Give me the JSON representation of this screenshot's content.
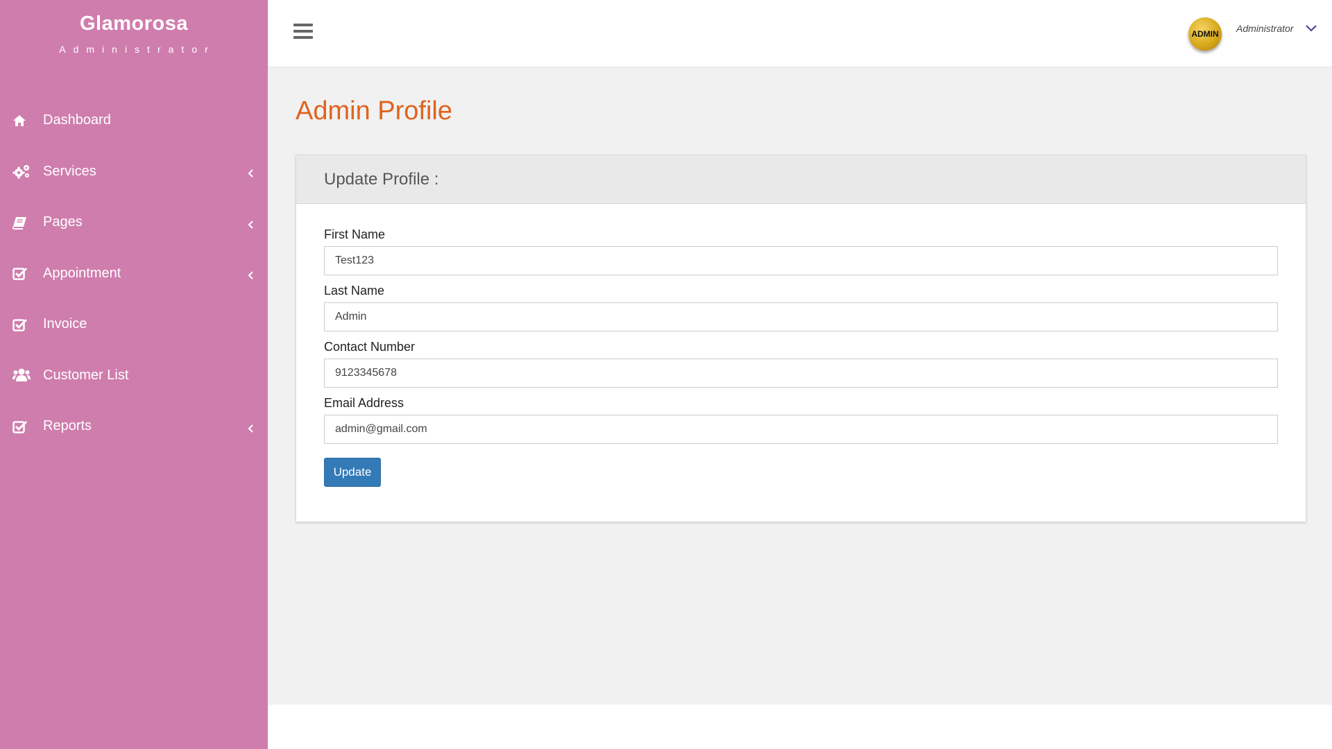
{
  "brand": {
    "title": "Glamorosa",
    "subtitle": "Administrator"
  },
  "sidebar": {
    "items": [
      {
        "label": "Dashboard",
        "icon": "home-icon",
        "has_submenu": false
      },
      {
        "label": "Services",
        "icon": "gears-icon",
        "has_submenu": true
      },
      {
        "label": "Pages",
        "icon": "book-icon",
        "has_submenu": true
      },
      {
        "label": "Appointment",
        "icon": "check-square-icon",
        "has_submenu": true
      },
      {
        "label": "Invoice",
        "icon": "check-square-icon",
        "has_submenu": false
      },
      {
        "label": "Customer List",
        "icon": "users-icon",
        "has_submenu": false
      },
      {
        "label": "Reports",
        "icon": "check-square-icon",
        "has_submenu": true
      }
    ]
  },
  "topbar": {
    "menu_icon": "hamburger-icon",
    "avatar_text": "ADMIN",
    "user_name": "Administrator",
    "dropdown_icon": "chevron-down-icon"
  },
  "main": {
    "page_title": "Admin Profile",
    "card_title": "Update Profile :",
    "fields": [
      {
        "label": "First Name",
        "value": "Test123"
      },
      {
        "label": "Last Name",
        "value": "Admin"
      },
      {
        "label": "Contact Number",
        "value": "9123345678"
      },
      {
        "label": "Email Address",
        "value": "admin@gmail.com"
      }
    ],
    "submit_label": "Update"
  },
  "colors": {
    "sidebar_bg": "#cf7dad",
    "title_accent": "#e0631d",
    "button_primary": "#337ab7",
    "content_bg": "#f1f1f1"
  }
}
